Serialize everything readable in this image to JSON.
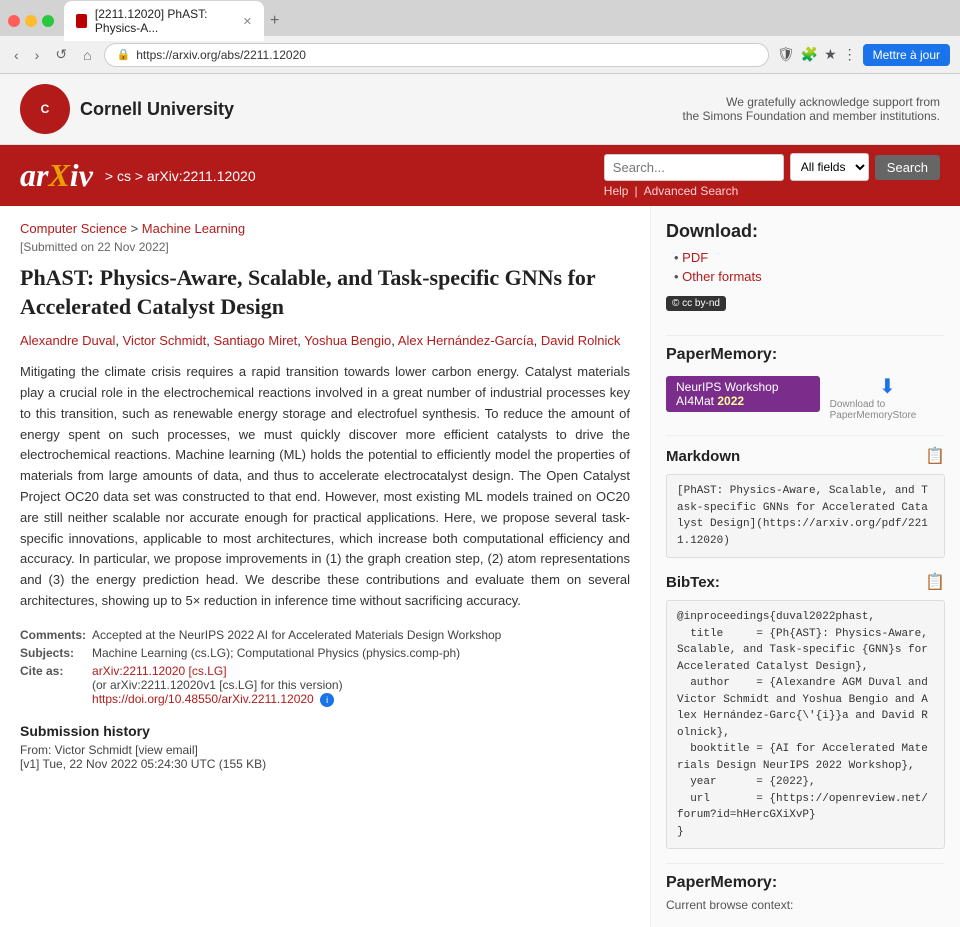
{
  "browser": {
    "tab_title": "[2211.12020] PhAST: Physics-A...",
    "url": "https://arxiv.org/abs/2211.12020",
    "update_btn": "Mettre à jour"
  },
  "header": {
    "cornell_name": "Cornell University",
    "simons_text": "We gratefully acknowledge support from\nthe Simons Foundation and member institutions."
  },
  "arxiv": {
    "logo": "arXiv",
    "breadcrumb": "> cs > arXiv:2211.12020",
    "search_placeholder": "Search...",
    "field_select_label": "All fields",
    "search_btn": "Search",
    "help_link": "Help",
    "advanced_search_link": "Advanced Search"
  },
  "breadcrumb": {
    "text": "Computer Science > Machine Learning"
  },
  "paper": {
    "submitted_date": "[Submitted on 22 Nov 2022]",
    "title": "PhAST: Physics-Aware, Scalable, and Task-specific GNNs for Accelerated Catalyst Design",
    "authors": [
      "Alexandre Duval",
      "Victor Schmidt",
      "Santiago Miret",
      "Yoshua Bengio",
      "Alex Hernández-García",
      "David Rolnick"
    ],
    "abstract": "Mitigating the climate crisis requires a rapid transition towards lower carbon energy. Catalyst materials play a crucial role in the electrochemical reactions involved in a great number of industrial processes key to this transition, such as renewable energy storage and electrofuel synthesis. To reduce the amount of energy spent on such processes, we must quickly discover more efficient catalysts to drive the electrochemical reactions. Machine learning (ML) holds the potential to efficiently model the properties of materials from large amounts of data, and thus to accelerate electrocatalyst design. The Open Catalyst Project OC20 data set was constructed to that end. However, most existing ML models trained on OC20 are still neither scalable nor accurate enough for practical applications. Here, we propose several task-specific innovations, applicable to most architectures, which increase both computational efficiency and accuracy. In particular, we propose improvements in (1) the graph creation step, (2) atom representations and (3) the energy prediction head. We describe these contributions and evaluate them on several architectures, showing up to 5× reduction in inference time without sacrificing accuracy.",
    "comments": "Accepted at the NeurIPS 2022 AI for Accelerated Materials Design Workshop",
    "subjects": "Machine Learning (cs.LG); Computational Physics (physics.comp-ph)",
    "cite_as_1": "arXiv:2211.12020 [cs.LG]",
    "cite_as_2": "(or arXiv:2211.12020v1 [cs.LG] for this version)",
    "doi": "https://doi.org/10.48550/arXiv.2211.12020",
    "submission_history_title": "Submission history",
    "submission_from": "From: Victor Schmidt",
    "view_email_link": "[view email]",
    "v1_entry": "[v1] Tue, 22 Nov 2022 05:24:30 UTC (155 KB)"
  },
  "sidebar": {
    "download_title": "Download:",
    "pdf_label": "PDF",
    "other_formats_label": "Other formats",
    "license_text": "cc by-nd",
    "papermemory_title": "PaperMemory:",
    "neurips_badge": "NeurIPS Workshop AI4Mat",
    "neurips_year": "2022",
    "markdown_title": "Markdown",
    "markdown_text": "[PhAST: Physics-Aware, Scalable, and Task-specific GNNs for Accelerated Catalyst Design](https://arxiv.org/pdf/2211.12020)",
    "bibtex_title": "BibTex:",
    "bibtex_text": "@inproceedings{duval2022phast,\n  title     = {Ph{AST}: Physics-Aware, Scalable, and Task-specific {GNN}s for Accelerated Catalyst Design},\n  author    = {Alexandre AGM Duval and Victor Schmidt and Yoshua Bengio and Alex Hernández-Garc{\\'{i}}a and David Rolnick},\n  booktitle = {AI for Accelerated Materials Design NeurIPS 2022 Workshop},\n  year      = {2022},\n  url       = {https://openreview.net/forum?id=hHercGXiXvP}\n}",
    "papermemory_footer_title": "PaperMemory:",
    "current_browse_context": "Current browse context:",
    "download_to_papermemory": "Download to PaperMemoryStore"
  }
}
